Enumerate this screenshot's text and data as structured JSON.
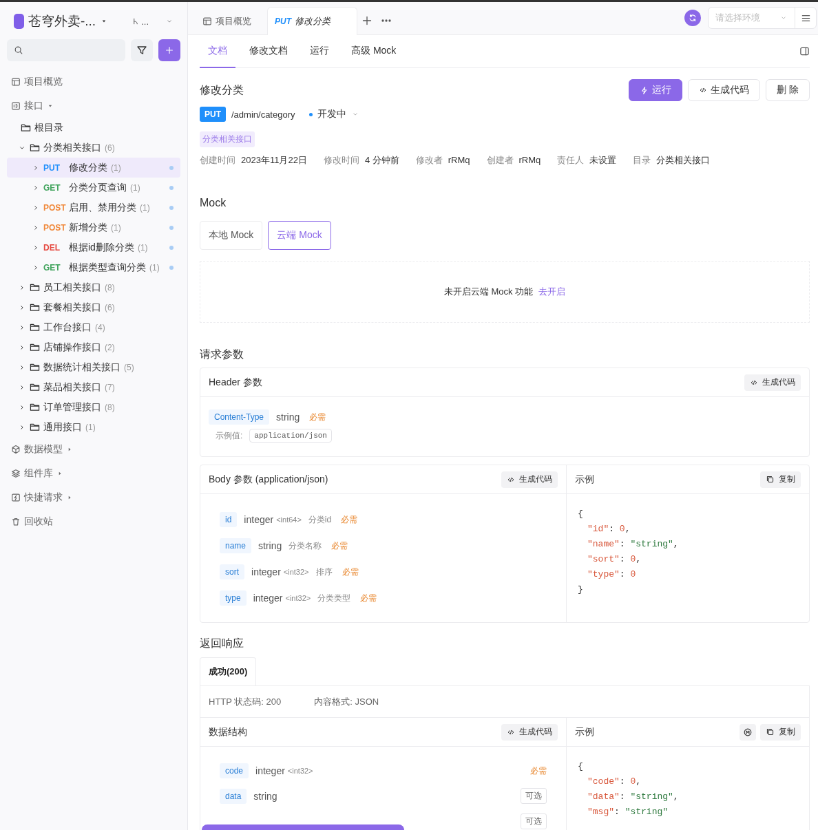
{
  "project": {
    "name": "苍穹外卖-...",
    "branch": "..."
  },
  "nav": [
    {
      "label": "项目概览",
      "kind": "overview"
    },
    {
      "label": "接口",
      "kind": "api",
      "expanded": true,
      "children": [
        {
          "label": "根目录",
          "kind": "folder"
        },
        {
          "label": "分类相关接口",
          "count": "(6)",
          "kind": "folder",
          "expanded": true,
          "children": [
            {
              "kind": "endpoint",
              "method": "PUT",
              "label": "修改分类",
              "count": "(1)",
              "selected": true
            },
            {
              "kind": "endpoint",
              "method": "GET",
              "label": "分类分页查询",
              "count": "(1)",
              "selected": false
            },
            {
              "kind": "endpoint",
              "method": "POST",
              "label": "启用、禁用分类",
              "count": "(1)",
              "selected": false
            },
            {
              "kind": "endpoint",
              "method": "POST",
              "label": "新增分类",
              "count": "(1)",
              "selected": false
            },
            {
              "kind": "endpoint",
              "method": "DEL",
              "label": "根据id删除分类",
              "count": "(1)",
              "selected": false
            },
            {
              "kind": "endpoint",
              "method": "GET",
              "label": "根据类型查询分类",
              "count": "(1)",
              "selected": false
            }
          ]
        },
        {
          "label": "员工相关接口",
          "count": "(8)",
          "kind": "folder",
          "expanded": false
        },
        {
          "label": "套餐相关接口",
          "count": "(6)",
          "kind": "folder",
          "expanded": false
        },
        {
          "label": "工作台接口",
          "count": "(4)",
          "kind": "folder",
          "expanded": false
        },
        {
          "label": "店铺操作接口",
          "count": "(2)",
          "kind": "folder",
          "expanded": false
        },
        {
          "label": "数据统计相关接口",
          "count": "(5)",
          "kind": "folder",
          "expanded": false
        },
        {
          "label": "菜品相关接口",
          "count": "(7)",
          "kind": "folder",
          "expanded": false
        },
        {
          "label": "订单管理接口",
          "count": "(8)",
          "kind": "folder",
          "expanded": false
        },
        {
          "label": "通用接口",
          "count": "(1)",
          "kind": "folder",
          "expanded": false
        }
      ]
    },
    {
      "label": "数据模型",
      "kind": "model",
      "expanded": false
    },
    {
      "label": "组件库",
      "kind": "components",
      "expanded": false
    },
    {
      "label": "快捷请求",
      "kind": "quick",
      "expanded": false
    },
    {
      "label": "回收站",
      "kind": "trash"
    }
  ],
  "tabs": [
    {
      "kind": "overview",
      "label": "项目概览",
      "selected": false
    },
    {
      "kind": "endpoint",
      "method": "PUT",
      "label": "修改分类",
      "selected": true
    }
  ],
  "env_select": {
    "placeholder": "请选择环境"
  },
  "subtabs": [
    {
      "label": "文档",
      "selected": true
    },
    {
      "label": "修改文档",
      "selected": false
    },
    {
      "label": "运行",
      "selected": false
    },
    {
      "label": "高级 Mock",
      "selected": false
    }
  ],
  "endpoint": {
    "title": "修改分类",
    "method": "PUT",
    "path": "/admin/category",
    "status": "开发中",
    "tag": "分类相关接口",
    "meta": [
      {
        "label": "创建时间",
        "value": "2023年11月22日"
      },
      {
        "label": "修改时间",
        "value": "4 分钟前"
      },
      {
        "label": "修改者",
        "value": "rRMq"
      },
      {
        "label": "创建者",
        "value": "rRMq"
      },
      {
        "label": "责任人",
        "value": "未设置"
      },
      {
        "label": "目录",
        "value": "分类相关接口"
      }
    ]
  },
  "actions": [
    {
      "label": "运行",
      "kind": "primary"
    },
    {
      "label": "生成代码",
      "kind": "code"
    },
    {
      "label": "删 除",
      "kind": "plain"
    }
  ],
  "mock": {
    "title": "Mock",
    "tabs": [
      {
        "label": "本地 Mock",
        "selected": false
      },
      {
        "label": "云端 Mock",
        "selected": true
      }
    ],
    "notice": "未开启云端 Mock 功能",
    "link": "去开启"
  },
  "request": {
    "title": "请求参数",
    "header": {
      "title": "Header 参数",
      "code_button": "生成代码",
      "params": [
        {
          "name": "Content-Type",
          "type": "string",
          "flag": "必需",
          "required": true,
          "example_label": "示例值:",
          "example": "application/json"
        }
      ]
    },
    "body": {
      "title": "Body 参数 (application/json)",
      "code_button": "生成代码",
      "params": [
        {
          "name": "id",
          "type": "integer",
          "format": "<int64>",
          "desc": "分类id",
          "flag": "必需",
          "required": true
        },
        {
          "name": "name",
          "type": "string",
          "desc": "分类名称",
          "flag": "必需",
          "required": true
        },
        {
          "name": "sort",
          "type": "integer",
          "format": "<int32>",
          "desc": "排序",
          "flag": "必需",
          "required": true
        },
        {
          "name": "type",
          "type": "integer",
          "format": "<int32>",
          "desc": "分类类型",
          "flag": "必需",
          "required": true
        }
      ],
      "example": {
        "title": "示例",
        "copy_button": "复制",
        "open": "{",
        "close": "}",
        "lines": [
          {
            "key": "\"id\"",
            "sep": ": ",
            "value": "0",
            "tail": ",",
            "kind": "number"
          },
          {
            "key": "\"name\"",
            "sep": ": ",
            "value": "\"string\"",
            "tail": ",",
            "kind": "string"
          },
          {
            "key": "\"sort\"",
            "sep": ": ",
            "value": "0",
            "tail": ",",
            "kind": "number"
          },
          {
            "key": "\"type\"",
            "sep": ": ",
            "value": "0",
            "kind": "number"
          }
        ]
      }
    }
  },
  "response": {
    "title": "返回响应",
    "tabs": [
      {
        "label": "成功(200)",
        "selected": true
      }
    ],
    "status": "HTTP 状态码: 200",
    "format": "内容格式: JSON",
    "schema": {
      "title": "数据结构",
      "code_button": "生成代码",
      "params": [
        {
          "name": "code",
          "type": "integer",
          "format": "<int32>",
          "flag": "必需",
          "required": true
        },
        {
          "name": "data",
          "type": "string",
          "flag": "可选",
          "required": false
        },
        {
          "flag": "可选",
          "required": false
        }
      ]
    },
    "example": {
      "title": "示例",
      "copy_button": "复制",
      "open": "{",
      "lines": [
        {
          "key": "\"code\"",
          "sep": ": ",
          "value": "0",
          "tail": ",",
          "kind": "number"
        },
        {
          "key": "\"data\"",
          "sep": ": ",
          "value": "\"string\"",
          "tail": ",",
          "kind": "string"
        },
        {
          "key": "\"msg\"",
          "sep": ": ",
          "value": "\"string\"",
          "kind": "string"
        }
      ]
    }
  }
}
